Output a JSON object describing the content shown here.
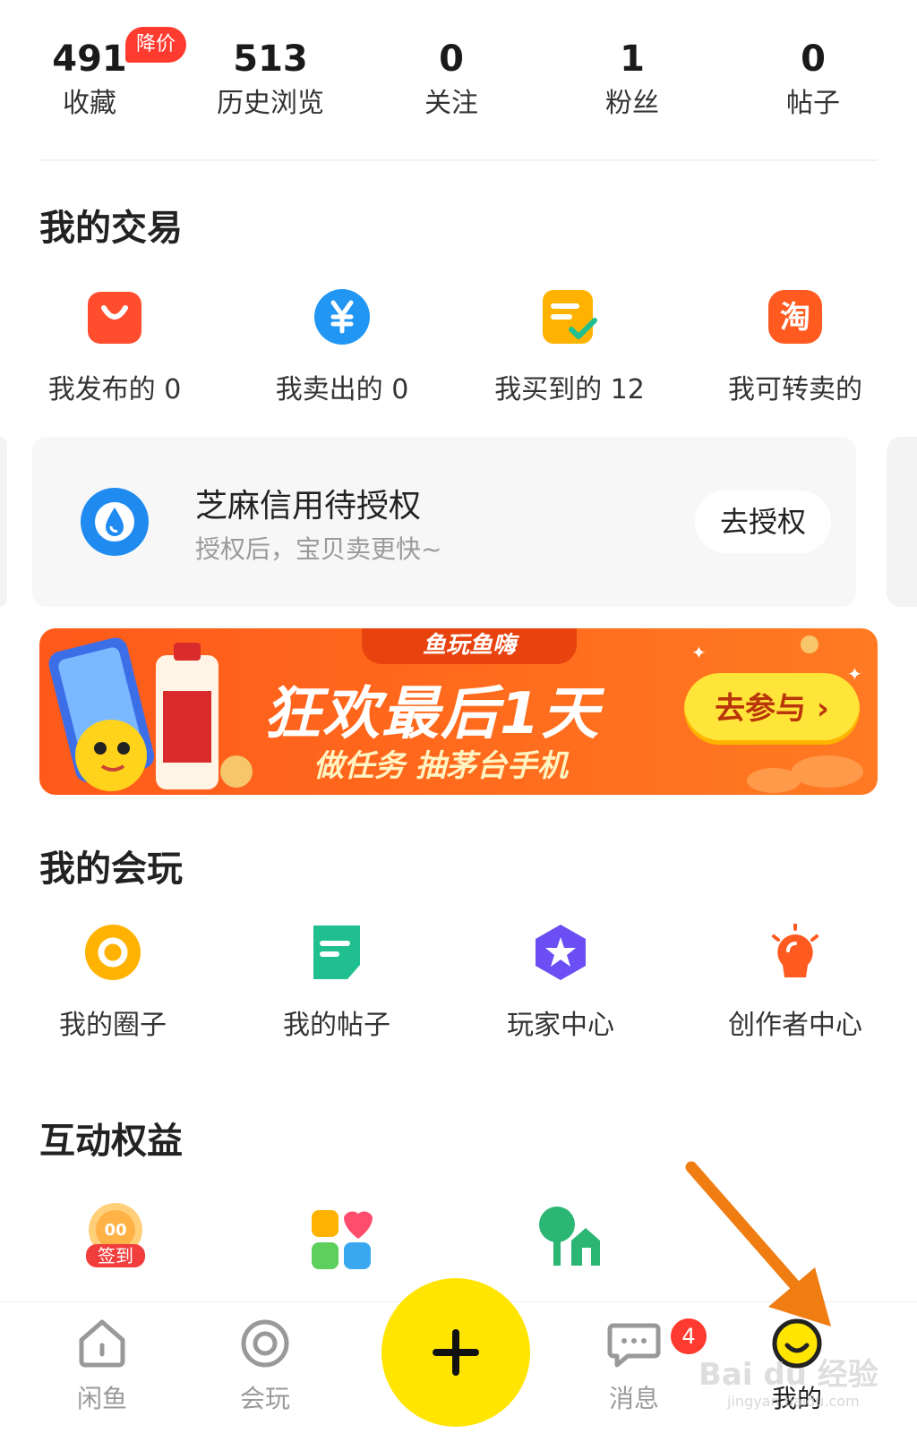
{
  "stats": [
    {
      "value": "491",
      "label": "收藏"
    },
    {
      "value": "513",
      "label": "历史浏览"
    },
    {
      "value": "0",
      "label": "关注"
    },
    {
      "value": "1",
      "label": "粉丝"
    },
    {
      "value": "0",
      "label": "帖子"
    }
  ],
  "stats_badge": "降价",
  "trade": {
    "title": "我的交易",
    "items": [
      {
        "label": "我发布的 0",
        "icon": "shopping-bag-icon",
        "color": "#ff4d2e"
      },
      {
        "label": "我卖出的 0",
        "icon": "yen-coin-icon",
        "color": "#2196f3"
      },
      {
        "label": "我买到的 12",
        "icon": "order-check-icon",
        "color": "#ffb300"
      },
      {
        "label": "我可转卖的",
        "icon": "taobao-icon",
        "color": "#ff5a1f"
      }
    ]
  },
  "credit": {
    "title": "芝麻信用待授权",
    "subtitle": "授权后，宝贝卖更快~",
    "button": "去授权",
    "icon": "sesame-credit-icon"
  },
  "banner": {
    "tag": "鱼玩鱼嗨",
    "headline": "狂欢最后1天",
    "subline": "做任务 抽茅台手机",
    "button": "去参与 ›"
  },
  "play": {
    "title": "我的会玩",
    "items": [
      {
        "label": "我的圈子",
        "icon": "circle-ring-icon",
        "color": "#ffb300"
      },
      {
        "label": "我的帖子",
        "icon": "post-note-icon",
        "color": "#1fbf8f"
      },
      {
        "label": "玩家中心",
        "icon": "star-badge-icon",
        "color": "#6b4ff5"
      },
      {
        "label": "创作者中心",
        "icon": "lightbulb-icon",
        "color": "#ff5a1f"
      }
    ]
  },
  "rights": {
    "title": "互动权益",
    "items": [
      {
        "icon": "checkin-icon",
        "badge": "签到"
      },
      {
        "icon": "hearts-puzzle-icon"
      },
      {
        "icon": "tree-house-icon"
      }
    ]
  },
  "nav": {
    "items": [
      {
        "label": "闲鱼",
        "icon": "home-icon"
      },
      {
        "label": "会玩",
        "icon": "target-icon"
      },
      {
        "label": "消息",
        "icon": "chat-icon",
        "badge": "4"
      },
      {
        "label": "我的",
        "icon": "smiley-face-icon"
      }
    ],
    "publish_icon": "plus-icon"
  },
  "watermark": {
    "text": "Bai du 经验",
    "sub": "jingyan.baidu.com"
  },
  "colors": {
    "accent_yellow": "#ffe500",
    "badge_red": "#ff3b30",
    "arrow_orange": "#f07d12"
  }
}
